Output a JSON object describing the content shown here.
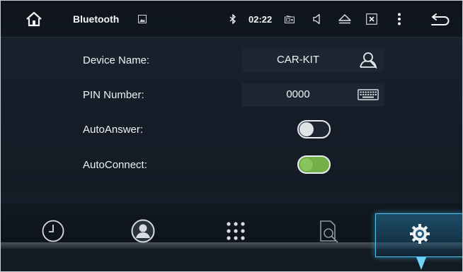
{
  "status_bar": {
    "title": "Bluetooth",
    "time": "02:22",
    "icons": [
      "home-icon",
      "gallery-icon",
      "bluetooth-icon",
      "radio-icon",
      "volume-icon",
      "eject-icon",
      "close-box-icon",
      "menu-icon",
      "back-icon"
    ]
  },
  "settings": {
    "device_name": {
      "label": "Device Name:",
      "value": "CAR-KIT",
      "icon": "user-icon"
    },
    "pin_number": {
      "label": "PIN Number:",
      "value": "0000",
      "icon": "keyboard-icon"
    },
    "auto_answer": {
      "label": "AutoAnswer:",
      "enabled": false
    },
    "auto_connect": {
      "label": "AutoConnect:",
      "enabled": true
    }
  },
  "bottom_nav": {
    "items": [
      {
        "name": "recent-calls",
        "icon": "clock-icon",
        "active": false
      },
      {
        "name": "contacts",
        "icon": "contact-icon",
        "active": false
      },
      {
        "name": "dialpad",
        "icon": "dialpad-icon",
        "active": false
      },
      {
        "name": "search-devices",
        "icon": "search-device-icon",
        "active": false
      },
      {
        "name": "settings",
        "icon": "gear-icon",
        "active": true
      }
    ]
  },
  "colors": {
    "accent": "#4bc2ef",
    "toggle_on": "#74b04a",
    "background": "#151d28"
  }
}
